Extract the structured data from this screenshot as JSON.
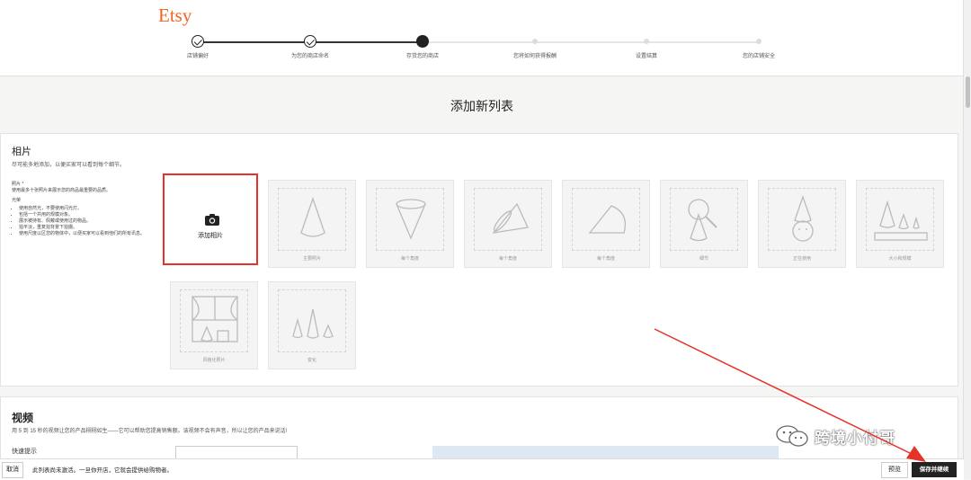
{
  "header": {
    "logo": "Etsy",
    "steps": [
      {
        "label": "店铺偏好",
        "state": "done"
      },
      {
        "label": "为您的商店命名",
        "state": "done"
      },
      {
        "label": "存货您的商店",
        "state": "current"
      },
      {
        "label": "您将如何获得报酬",
        "state": "todo"
      },
      {
        "label": "设置结算",
        "state": "todo"
      },
      {
        "label": "您的店铺安全",
        "state": "todo"
      }
    ]
  },
  "page_title": "添加新列表",
  "photos": {
    "title": "相片",
    "subtitle": "尽可能多地添加，以便买家可以看到每个细节。",
    "tips_title": "照片 *",
    "tips_intro": "使用最多十张照片来展示您的商品最重要的品质。",
    "tips_heading": "光荣",
    "tips": [
      "使用自然光，不要使用闪光灯。",
      "包括一个共用的规模对象。",
      "展示被持有、佩戴或使用过的物品。",
      "拍平淡，重复拍背景下拍摄。",
      "使用尺度以区您的物体中，以便买家可以看到他们的所有讯息。"
    ],
    "add_label": "添加相片",
    "tiles": [
      {
        "caption": "主要照片",
        "icon": "cone-icon"
      },
      {
        "caption": "每个角度",
        "icon": "cone-top-icon"
      },
      {
        "caption": "每个角度",
        "icon": "cone-side-icon"
      },
      {
        "caption": "每个角度",
        "icon": "cone-base-icon"
      },
      {
        "caption": "细节",
        "icon": "magnifier-cone-icon"
      },
      {
        "caption": "正在使用",
        "icon": "cone-hat-icon"
      },
      {
        "caption": "大小和规模",
        "icon": "cones-ruler-icon"
      },
      {
        "caption": "风格化照片",
        "icon": "styled-room-icon"
      },
      {
        "caption": "变化",
        "icon": "cone-variations-icon"
      }
    ]
  },
  "video": {
    "title": "视频",
    "subtitle": "用 5 到 15 秒的视频让您的产品栩栩如生——它可以帮助您提高销售额。该视频不会有声音，所以让您的产品来说话!",
    "field_label": "快速提示"
  },
  "bottom": {
    "cancel": "取消",
    "message": "此列表尚未激活。一旦你开店，它就会提供给购物者。",
    "preview": "预览",
    "save": "保存并继续"
  },
  "watermark": "跨境小付哥",
  "colors": {
    "brand": "#f1641e",
    "highlight": "#e5332a",
    "primary_button": "#222222"
  }
}
